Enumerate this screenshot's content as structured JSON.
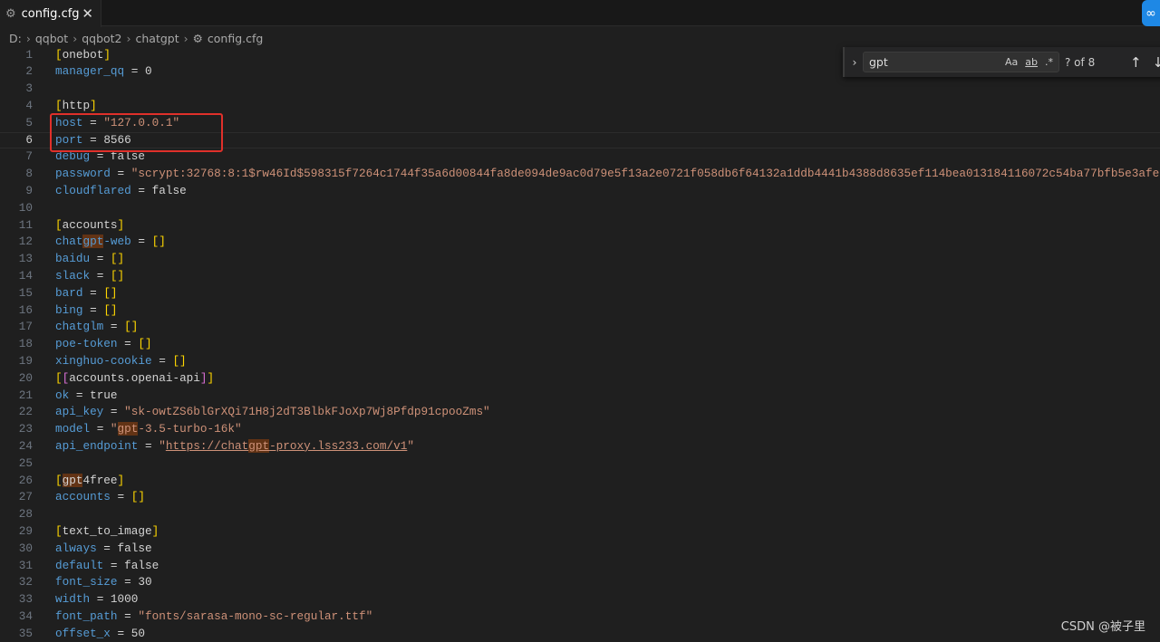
{
  "tab": {
    "title": "config.cfg",
    "icon": "gear-icon",
    "close": "✕"
  },
  "breadcrumb": [
    "D:",
    "qqbot",
    "qqbot2",
    "chatgpt",
    "config.cfg"
  ],
  "find": {
    "query": "gpt",
    "match_case": "Aa",
    "whole_word": "ab",
    "regex": ".*",
    "count": "? of 8",
    "prev": "↑",
    "next": "↓"
  },
  "current_line": 6,
  "colors": {
    "key": "#569cd6",
    "string": "#ce9178",
    "bracket": "#ffd700",
    "match_highlight": "#623315",
    "annotation_box": "#e0302a"
  },
  "editor": {
    "lines": [
      [
        [
          "b",
          "["
        ],
        [
          "x",
          "onebot"
        ],
        [
          "b",
          "]"
        ]
      ],
      [
        [
          "k",
          "manager_qq"
        ],
        [
          "o",
          " = "
        ],
        [
          "v",
          "0"
        ]
      ],
      [],
      [
        [
          "b",
          "["
        ],
        [
          "x",
          "http"
        ],
        [
          "b",
          "]"
        ]
      ],
      [
        [
          "k",
          "host"
        ],
        [
          "o",
          " = "
        ],
        [
          "s",
          "\"127.0.0.1\""
        ]
      ],
      [
        [
          "k",
          "port"
        ],
        [
          "o",
          " = "
        ],
        [
          "v",
          "8566"
        ]
      ],
      [
        [
          "k",
          "debug"
        ],
        [
          "o",
          " = "
        ],
        [
          "v",
          "false"
        ]
      ],
      [
        [
          "k",
          "password"
        ],
        [
          "o",
          " = "
        ],
        [
          "s",
          "\"scrypt:32768:8:1$rw46Id$598315f7264c1744f35a6d00844fa8de094de9ac0d79e5f13a2e0721f058db6f64132a1ddb4441b4388d8635ef114bea013184116072c54ba77bfb5e3afe"
        ]
      ],
      [
        [
          "k",
          "cloudflared"
        ],
        [
          "o",
          " = "
        ],
        [
          "v",
          "false"
        ]
      ],
      [],
      [
        [
          "b",
          "["
        ],
        [
          "x",
          "accounts"
        ],
        [
          "b",
          "]"
        ]
      ],
      [
        [
          "k",
          "chat"
        ],
        [
          "kh",
          "gpt"
        ],
        [
          "k",
          "-web"
        ],
        [
          "o",
          " = "
        ],
        [
          "b",
          "[]"
        ]
      ],
      [
        [
          "k",
          "baidu"
        ],
        [
          "o",
          " = "
        ],
        [
          "b",
          "[]"
        ]
      ],
      [
        [
          "k",
          "slack"
        ],
        [
          "o",
          " = "
        ],
        [
          "b",
          "[]"
        ]
      ],
      [
        [
          "k",
          "bard"
        ],
        [
          "o",
          " = "
        ],
        [
          "b",
          "[]"
        ]
      ],
      [
        [
          "k",
          "bing"
        ],
        [
          "o",
          " = "
        ],
        [
          "b",
          "[]"
        ]
      ],
      [
        [
          "k",
          "chatglm"
        ],
        [
          "o",
          " = "
        ],
        [
          "b",
          "[]"
        ]
      ],
      [
        [
          "k",
          "poe-token"
        ],
        [
          "o",
          " = "
        ],
        [
          "b",
          "[]"
        ]
      ],
      [
        [
          "k",
          "xinghuo-cookie"
        ],
        [
          "o",
          " = "
        ],
        [
          "b",
          "[]"
        ]
      ],
      [
        [
          "b",
          "["
        ],
        [
          "p",
          "["
        ],
        [
          "x",
          "accounts.openai-api"
        ],
        [
          "p",
          "]"
        ],
        [
          "b",
          "]"
        ]
      ],
      [
        [
          "k",
          "ok"
        ],
        [
          "o",
          " = "
        ],
        [
          "v",
          "true"
        ]
      ],
      [
        [
          "k",
          "api_key"
        ],
        [
          "o",
          " = "
        ],
        [
          "s",
          "\"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\""
        ]
      ],
      [
        [
          "k",
          "model"
        ],
        [
          "o",
          " = "
        ],
        [
          "s",
          "\""
        ],
        [
          "sh",
          "gpt"
        ],
        [
          "s",
          "-3.5-turbo-16k\""
        ]
      ],
      [
        [
          "k",
          "api_endpoint"
        ],
        [
          "o",
          " = "
        ],
        [
          "s",
          "\""
        ],
        [
          "u",
          "https://chat"
        ],
        [
          "uh",
          "gpt"
        ],
        [
          "u",
          "-proxy.lss233.com/v1"
        ],
        [
          "s",
          "\""
        ]
      ],
      [],
      [
        [
          "b",
          "["
        ],
        [
          "xh",
          "gpt"
        ],
        [
          "x",
          "4free"
        ],
        [
          "b",
          "]"
        ]
      ],
      [
        [
          "k",
          "accounts"
        ],
        [
          "o",
          " = "
        ],
        [
          "b",
          "[]"
        ]
      ],
      [],
      [
        [
          "b",
          "["
        ],
        [
          "x",
          "text_to_image"
        ],
        [
          "b",
          "]"
        ]
      ],
      [
        [
          "k",
          "always"
        ],
        [
          "o",
          " = "
        ],
        [
          "v",
          "false"
        ]
      ],
      [
        [
          "k",
          "default"
        ],
        [
          "o",
          " = "
        ],
        [
          "v",
          "false"
        ]
      ],
      [
        [
          "k",
          "font_size"
        ],
        [
          "o",
          " = "
        ],
        [
          "v",
          "30"
        ]
      ],
      [
        [
          "k",
          "width"
        ],
        [
          "o",
          " = "
        ],
        [
          "v",
          "1000"
        ]
      ],
      [
        [
          "k",
          "font_path"
        ],
        [
          "o",
          " = "
        ],
        [
          "s",
          "\"fonts/sarasa-mono-sc-regular.ttf\""
        ]
      ],
      [
        [
          "k",
          "offset_x"
        ],
        [
          "o",
          " = "
        ],
        [
          "v",
          "50"
        ]
      ]
    ]
  },
  "watermark": "CSDN @被子里"
}
